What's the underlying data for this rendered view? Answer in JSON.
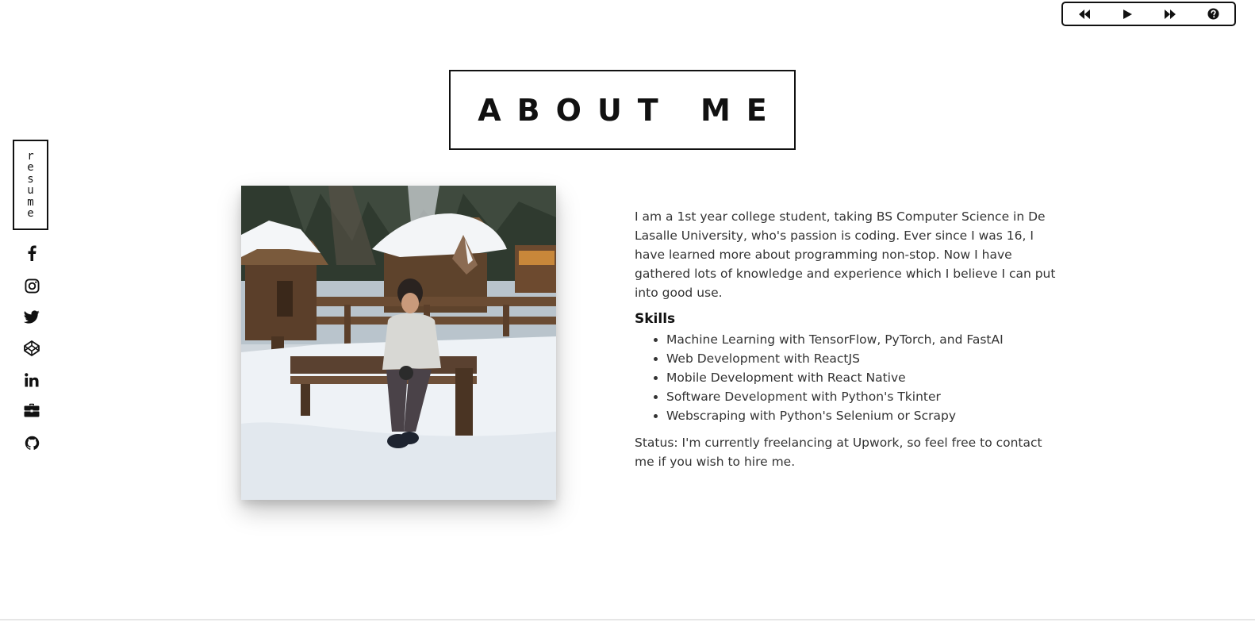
{
  "controls": {
    "rewind_icon": "rewind-icon",
    "play_icon": "play-icon",
    "fast_forward_icon": "fast-forward-icon",
    "help_icon": "help-icon"
  },
  "sidebar": {
    "resume_label": "resume",
    "links": [
      {
        "icon": "facebook-icon"
      },
      {
        "icon": "instagram-icon"
      },
      {
        "icon": "twitter-icon"
      },
      {
        "icon": "codepen-icon"
      },
      {
        "icon": "linkedin-icon"
      },
      {
        "icon": "briefcase-icon"
      },
      {
        "icon": "github-icon"
      }
    ]
  },
  "title": "ABOUT ME",
  "about": {
    "bio": "I am a 1st year college student, taking BS Computer Science in De Lasalle University, who's passion is coding. Ever since I was 16, I have learned more about programming non-stop. Now I have gathered lots of knowledge and experience which I believe I can put into good use.",
    "skills_heading": "Skills",
    "skills": [
      "Machine Learning with TensorFlow, PyTorch, and FastAI",
      "Web Development with ReactJS",
      "Mobile Development with React Native",
      "Software Development with Python's Tkinter",
      "Webscraping with Python's Selenium or Scrapy"
    ],
    "status": "Status: I'm currently freelancing at Upwork, so feel free to contact me if you wish to hire me."
  }
}
